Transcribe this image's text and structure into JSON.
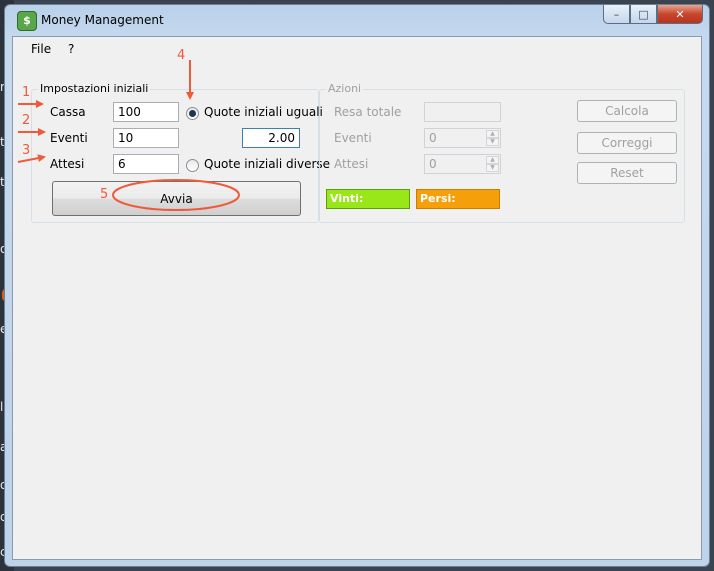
{
  "window": {
    "title": "Money Management",
    "app_icon_glyph": "$"
  },
  "menu": {
    "items": [
      "File",
      "?"
    ]
  },
  "settings_group": {
    "title": "Impostazioni iniziali",
    "fields": [
      {
        "label": "Cassa",
        "value": "100"
      },
      {
        "label": "Eventi",
        "value": "10"
      },
      {
        "label": "Attesi",
        "value": "6"
      }
    ],
    "radio_equal": {
      "label": "Quote iniziali uguali",
      "checked": true
    },
    "radio_different": {
      "label": "Quote iniziali diverse",
      "checked": false
    },
    "odds_value": "2.00",
    "start_button": "Avvia"
  },
  "actions_group": {
    "title": "Azioni",
    "resa_label": "Resa totale",
    "resa_value": "",
    "eventi_label": "Eventi",
    "eventi_value": "0",
    "attesi_label": "Attesi",
    "attesi_value": "0",
    "buttons": [
      "Calcola",
      "Correggi",
      "Reset"
    ],
    "vinti_label": "Vinti:",
    "persi_label": "Persi:"
  },
  "annotations": [
    "1",
    "2",
    "3",
    "4",
    "5"
  ],
  "colors": {
    "vinti_bg": "#99e619",
    "persi_bg": "#f5a00a",
    "annotation": "#f05a3a"
  }
}
